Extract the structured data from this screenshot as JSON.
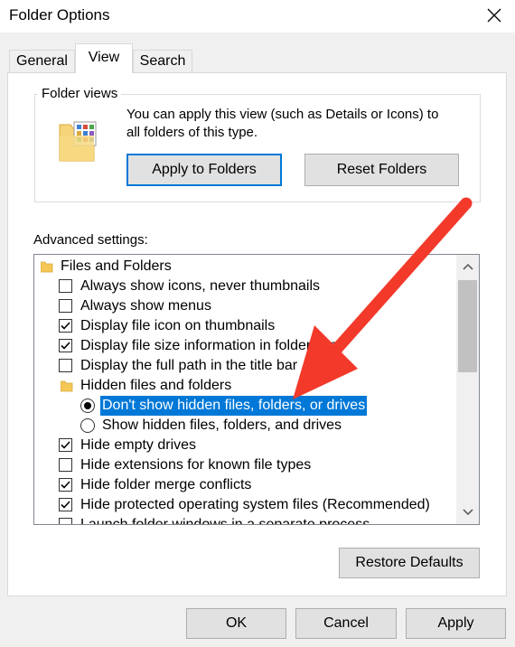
{
  "window": {
    "title": "Folder Options"
  },
  "tabs": [
    {
      "label": "General"
    },
    {
      "label": "View"
    },
    {
      "label": "Search"
    }
  ],
  "folder_views": {
    "legend": "Folder views",
    "description_line1": "You can apply this view (such as Details or Icons) to",
    "description_line2": "all folders of this type.",
    "apply_button": "Apply to Folders",
    "reset_button": "Reset Folders"
  },
  "advanced": {
    "label": "Advanced settings:",
    "items": [
      {
        "type": "folder",
        "label": "Files and Folders"
      },
      {
        "type": "checkbox",
        "checked": false,
        "label": "Always show icons, never thumbnails"
      },
      {
        "type": "checkbox",
        "checked": false,
        "label": "Always show menus"
      },
      {
        "type": "checkbox",
        "checked": true,
        "label": "Display file icon on thumbnails"
      },
      {
        "type": "checkbox",
        "checked": true,
        "label": "Display file size information in folder tips"
      },
      {
        "type": "checkbox",
        "checked": false,
        "label": "Display the full path in the title bar"
      },
      {
        "type": "folder",
        "label": "Hidden files and folders"
      },
      {
        "type": "radio",
        "checked": true,
        "selected": true,
        "label": "Don't show hidden files, folders, or drives"
      },
      {
        "type": "radio",
        "checked": false,
        "label": "Show hidden files, folders, and drives"
      },
      {
        "type": "checkbox",
        "checked": true,
        "label": "Hide empty drives"
      },
      {
        "type": "checkbox",
        "checked": false,
        "label": "Hide extensions for known file types"
      },
      {
        "type": "checkbox",
        "checked": true,
        "label": "Hide folder merge conflicts"
      },
      {
        "type": "checkbox",
        "checked": true,
        "label": "Hide protected operating system files (Recommended)"
      },
      {
        "type": "checkbox",
        "checked": false,
        "label": "Launch folder windows in a separate process"
      }
    ]
  },
  "restore_defaults": "Restore Defaults",
  "footer": {
    "ok": "OK",
    "cancel": "Cancel",
    "apply": "Apply"
  },
  "colors": {
    "selection": "#0078d7",
    "annotation_arrow": "#f2392a",
    "primary_border": "#0078d7"
  }
}
